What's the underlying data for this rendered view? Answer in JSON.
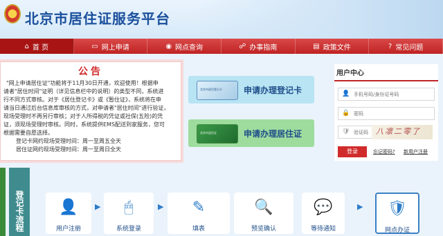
{
  "header": {
    "title": "北京市居住证服务平台"
  },
  "nav": [
    {
      "label": "首  页",
      "icon": "home-icon",
      "glyph": "⌂"
    },
    {
      "label": "网上申请",
      "icon": "monitor-icon",
      "glyph": "▭"
    },
    {
      "label": "网点查询",
      "icon": "search-icon",
      "glyph": "◉"
    },
    {
      "label": "办事指南",
      "icon": "guide-icon",
      "glyph": "☍"
    },
    {
      "label": "政策文件",
      "icon": "document-icon",
      "glyph": "▤"
    },
    {
      "label": "常见问题",
      "icon": "question-icon",
      "glyph": "?"
    }
  ],
  "notice": {
    "title": "公告",
    "lines": [
      "\"网上申请居住证\"功能将于11月30日开通，欢迎使用！根据申",
      "请者\"居住时间\"证明（详见信息栏中的说明）的类型不同，系统进",
      "行不同方式审核。对于《居住登记卡》或《暂住证》，系统将在申",
      "请当日通过后台信息库审核的方式，对申请者\"居住时间\"进行验证，",
      "现场受理时不再另行审核；对于人所得税的凭证或社保(五险)的凭",
      "证，须现场受理时审核。同时，系统提供EMS配送到家服务，您可",
      "根据需要自愿选择。"
    ],
    "times": [
      "登记卡网约现场受理时间：周一至周五全天",
      "居住证网约现场受理时间：周一至周日全天"
    ]
  },
  "apply": {
    "card": {
      "label": "申请办理登记卡",
      "card_text": "北京市居住登记卡"
    },
    "permit": {
      "label": "申请办理居住证",
      "card_text": "北京市居住证"
    }
  },
  "user_center": {
    "title": "用户中心",
    "username_placeholder": "手机号码/身份证号码",
    "password_placeholder": "密码",
    "code_placeholder": "验证码",
    "captcha": "八凛二零了",
    "login": "登录",
    "forgot": "忘记密码?",
    "register": "新用户注册"
  },
  "process": {
    "title": "登记卡流程",
    "steps": [
      {
        "label": "用户注册",
        "icon": "user-add-icon",
        "glyph": "👤"
      },
      {
        "label": "系统登录",
        "icon": "mouse-icon",
        "glyph": "🖱"
      },
      {
        "label": "填表",
        "icon": "form-edit-icon",
        "glyph": "✎"
      },
      {
        "label": "预览确认",
        "icon": "preview-icon",
        "glyph": "🔍"
      },
      {
        "label": "等待通知",
        "icon": "notification-icon",
        "glyph": "💬"
      },
      {
        "label": "网点办证",
        "icon": "police-emblem-icon",
        "glyph": "🛡"
      }
    ]
  }
}
